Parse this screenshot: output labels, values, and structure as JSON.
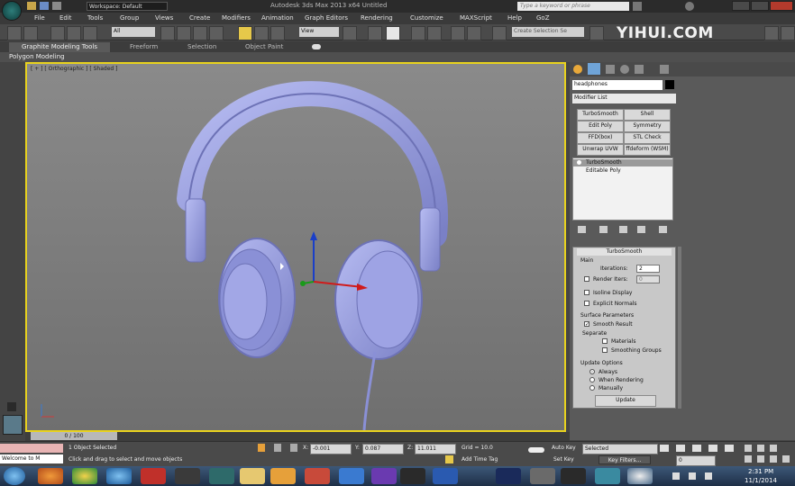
{
  "window": {
    "title": "Autodesk 3ds Max 2013 x64   Untitled",
    "workspace": "Workspace: Default",
    "search_placeholder": "Type a keyword or phrase"
  },
  "menu": [
    "File",
    "Edit",
    "Tools",
    "Group",
    "Views",
    "Create",
    "Modifiers",
    "Animation",
    "Graph Editors",
    "Rendering",
    "Customize",
    "MAXScript",
    "Help",
    "GoZ"
  ],
  "toolbar": {
    "filter": "All",
    "view": "View",
    "selection_set": "Create Selection Se"
  },
  "watermark": "YIHUI.COM",
  "ribbon": {
    "tabs": [
      "Graphite Modeling Tools",
      "Freeform",
      "Selection",
      "Object Paint"
    ],
    "sub": "Polygon Modeling"
  },
  "viewport": {
    "label": "[ + ] [ Orthographic ] [ Shaded ]"
  },
  "command_panel": {
    "object_name": "headphones",
    "modifier_list": "Modifier List",
    "buttons": [
      "TurboSmooth",
      "Shell",
      "Edit Poly",
      "Symmetry",
      "FFD(box)",
      "STL Check",
      "Unwrap UVW",
      "ffdeform (WSM)"
    ],
    "stack": [
      "TurboSmooth",
      "Editable Poly"
    ],
    "rollout_title": "TurboSmooth",
    "main_label": "Main",
    "iterations_label": "Iterations:",
    "iterations_value": "2",
    "render_iters_label": "Render Iters:",
    "render_iters_value": "0",
    "isoline": "Isoline Display",
    "explicit": "Explicit Normals",
    "surface_params": "Surface Parameters",
    "smooth_result": "Smooth Result",
    "separate": "Separate",
    "materials": "Materials",
    "smoothing_groups": "Smoothing Groups",
    "update_options": "Update Options",
    "always": "Always",
    "when_rendering": "When Rendering",
    "manually": "Manually",
    "update_btn": "Update"
  },
  "timeline": {
    "frame": "0 / 100"
  },
  "status": {
    "selected": "1 Object Selected",
    "prompt": "Click and drag to select and move objects",
    "welcome": "Welcome to M",
    "x": "-0.001",
    "y": "0.087",
    "z": "11.011",
    "grid": "Grid = 10.0",
    "auto_key": "Auto Key",
    "set_key": "Set Key",
    "key_filter": "Selected",
    "key_filters_btn": "Key Filters...",
    "add_time_tag": "Add Time Tag",
    "frame_value": "0"
  },
  "clock": {
    "time": "2:31 PM",
    "date": "11/1/2014"
  },
  "colors": {
    "viewport_border": "#e8d21e",
    "model": "#9aa0e0"
  }
}
